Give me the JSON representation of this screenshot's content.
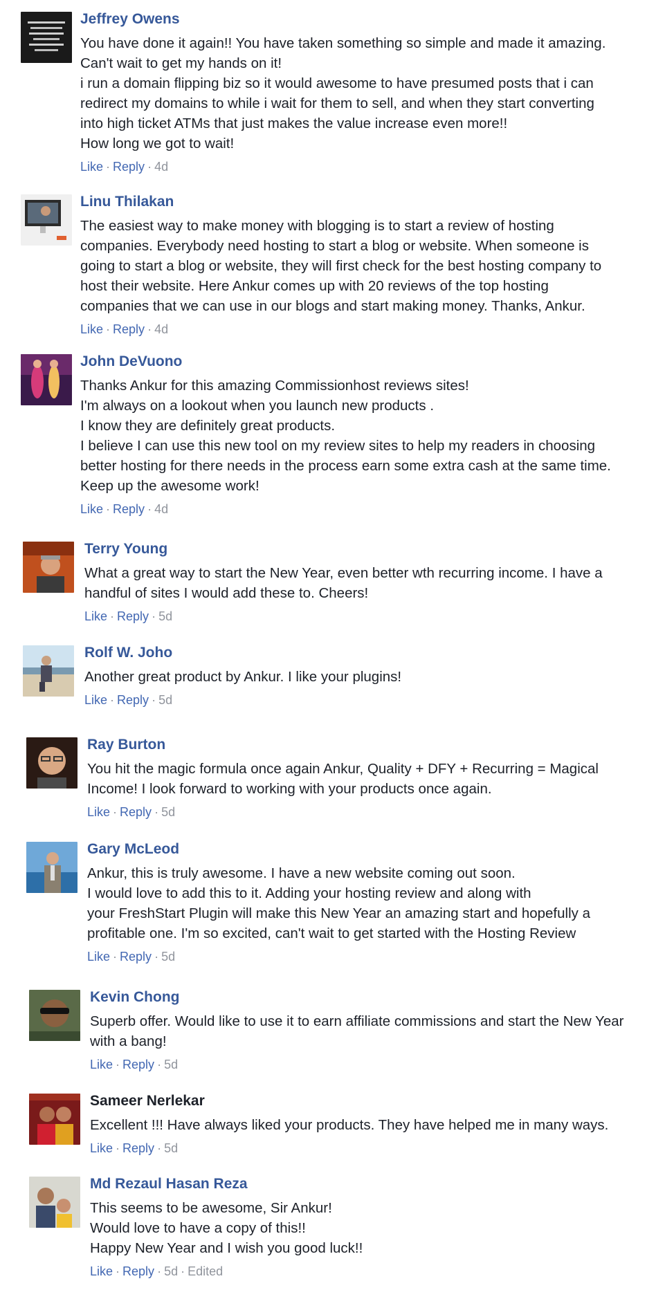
{
  "comments": [
    {
      "name": "Jeffrey Owens",
      "lines": [
        "You have done it again!! You have taken something so simple and made it amazing.",
        "Can't wait to get my hands on it!",
        "i run a domain flipping biz so it would awesome to have presumed posts that i can",
        "redirect my domains to while i wait for them to sell, and when they start converting",
        "into high ticket ATMs that just makes the value increase even more!!",
        "How long we got to wait!"
      ],
      "like": "Like",
      "reply": "Reply",
      "time": "4d"
    },
    {
      "name": "Linu Thilakan",
      "lines": [
        "The easiest way to make money with blogging is to start a review of hosting",
        "companies. Everybody need hosting to start a blog or website. When someone is",
        "going to start a blog or website, they will first check for the best hosting company to",
        "host their website. Here Ankur comes up with 20 reviews of the top hosting",
        "companies that we can use in our blogs and start making money. Thanks, Ankur."
      ],
      "like": "Like",
      "reply": "Reply",
      "time": "4d"
    },
    {
      "name": "John DeVuono",
      "lines": [
        "Thanks Ankur for this amazing Commissionhost reviews sites!",
        "I'm always on a lookout when you launch new products .",
        "I know they are definitely great products.",
        "I believe I can use this new tool on my review sites to help my readers in choosing",
        "better hosting for there needs in the process earn some extra cash at the same time.",
        "Keep up the awesome work!"
      ],
      "like": "Like",
      "reply": "Reply",
      "time": "4d"
    },
    {
      "name": "Terry Young",
      "lines": [
        "What a great way to start the New Year, even better wth recurring income. I have a",
        "handful of sites I would add these to. Cheers!"
      ],
      "like": "Like",
      "reply": "Reply",
      "time": "5d"
    },
    {
      "name": "Rolf W. Joho",
      "lines": [
        "Another great product by Ankur. I like your plugins!"
      ],
      "like": "Like",
      "reply": "Reply",
      "time": "5d"
    },
    {
      "name": "Ray Burton",
      "lines": [
        "You hit the magic formula once again Ankur, Quality + DFY + Recurring = Magical",
        "Income! I look forward to working with your products once again."
      ],
      "like": "Like",
      "reply": "Reply",
      "time": "5d"
    },
    {
      "name": "Gary McLeod",
      "lines": [
        "Ankur, this is truly awesome. I have a new website coming out soon.",
        "I would love to add this to it. Adding your hosting review and along with",
        "your FreshStart Plugin will make this New Year an amazing start and hopefully a",
        "profitable one. I'm so excited, can't wait to get started with the Hosting Review"
      ],
      "like": "Like",
      "reply": "Reply",
      "time": "5d"
    },
    {
      "name": "Kevin Chong",
      "lines": [
        "Superb offer. Would like to use it to earn affiliate commissions and start the New Year",
        "with a bang!"
      ],
      "like": "Like",
      "reply": "Reply",
      "time": "5d"
    },
    {
      "name": "Sameer Nerlekar",
      "lines": [
        "Excellent !!! Have always liked your products. They have helped me in many ways."
      ],
      "like": "Like",
      "reply": "Reply",
      "time": "5d"
    },
    {
      "name": "Md Rezaul Hasan Reza",
      "lines": [
        "This seems to be awesome, Sir Ankur!",
        "Would love to have a copy of this!!",
        "Happy New Year and I wish you good luck!!"
      ],
      "like": "Like",
      "reply": "Reply",
      "time": "5d",
      "edited": "Edited"
    }
  ],
  "colors": {
    "name_link": "#365899",
    "action_link": "#4267b2",
    "meta_gray": "#90949c",
    "body_text": "#1d2129"
  }
}
